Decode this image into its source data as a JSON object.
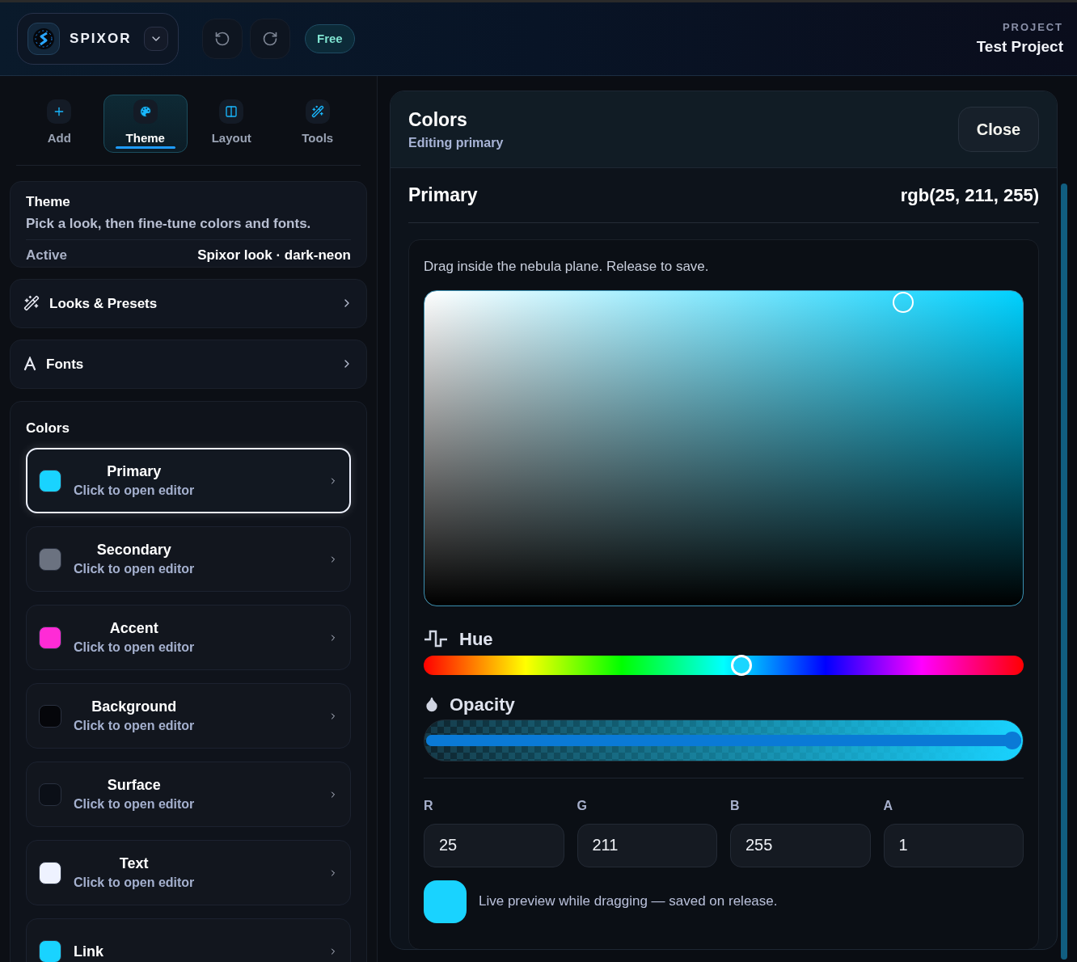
{
  "header": {
    "brand": "SPIXOR",
    "plan_badge": "Free",
    "project_label": "PROJECT",
    "project_name": "Test Project"
  },
  "tabs": [
    {
      "label": "Add",
      "kind": "add",
      "selected": false
    },
    {
      "label": "Theme",
      "kind": "theme",
      "selected": true
    },
    {
      "label": "Layout",
      "kind": "layout",
      "selected": false
    },
    {
      "label": "Tools",
      "kind": "tools",
      "selected": false
    }
  ],
  "theme_card": {
    "title": "Theme",
    "description": "Pick a look, then fine-tune colors and fonts.",
    "active_label": "Active",
    "active_value": "Spixor look · dark-neon"
  },
  "sections": [
    {
      "label": "Looks & Presets",
      "kind": "looks"
    },
    {
      "label": "Fonts",
      "kind": "fonts"
    }
  ],
  "colors": {
    "title": "Colors",
    "items": [
      {
        "name": "Primary",
        "hint": "Click to open editor",
        "color": "#19d3ff",
        "selected": true
      },
      {
        "name": "Secondary",
        "hint": "Click to open editor",
        "color": "#6b7280",
        "selected": false
      },
      {
        "name": "Accent",
        "hint": "Click to open editor",
        "color": "#ff2bd6",
        "selected": false
      },
      {
        "name": "Background",
        "hint": "Click to open editor",
        "color": "#05060a",
        "selected": false
      },
      {
        "name": "Surface",
        "hint": "Click to open editor",
        "color": "#0b0f17",
        "selected": false
      },
      {
        "name": "Text",
        "hint": "Click to open editor",
        "color": "#eef2ff",
        "selected": false
      },
      {
        "name": "Link",
        "color": "#19d3ff",
        "selected": false
      }
    ]
  },
  "editor": {
    "title": "Colors",
    "subtitle": "Editing primary",
    "close": "Close",
    "color_name": "Primary",
    "color_value": "rgb(25, 211, 255)",
    "instructions": "Drag inside the nebula plane. Release to save.",
    "hue": {
      "label": "Hue",
      "level": 0.53
    },
    "opacity": {
      "label": "Opacity",
      "level": 1
    },
    "channels": [
      {
        "label": "R",
        "value": "25"
      },
      {
        "label": "G",
        "value": "211"
      },
      {
        "label": "B",
        "value": "255"
      },
      {
        "label": "A",
        "value": "1"
      }
    ],
    "preview_text": "Live preview while dragging — saved on release."
  }
}
